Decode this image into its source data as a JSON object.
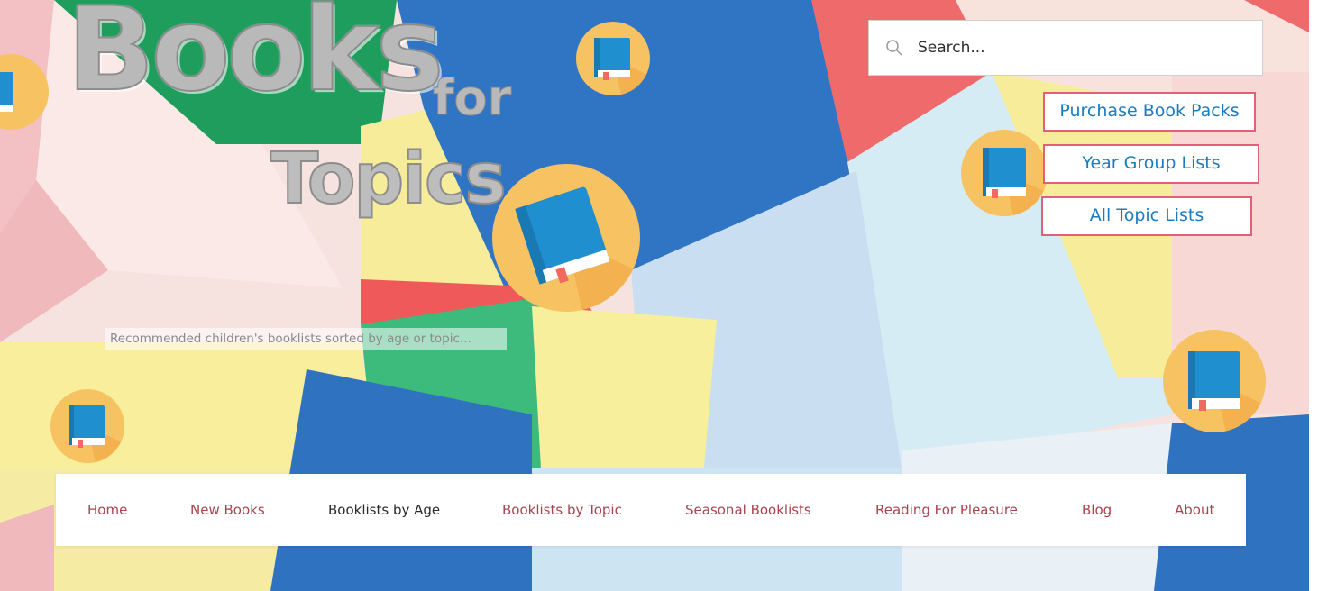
{
  "site": {
    "logo": {
      "word1": "Books",
      "word2": "for",
      "word3": "Topics"
    },
    "tagline": "Recommended children's booklists sorted by age or topic..."
  },
  "search": {
    "placeholder": "Search...",
    "icon": "search-icon"
  },
  "side_links": [
    {
      "label": "Purchase Book Packs"
    },
    {
      "label": "Year Group Lists"
    },
    {
      "label": "All Topic Lists"
    }
  ],
  "nav": {
    "items": [
      {
        "label": "Home",
        "active": false
      },
      {
        "label": "New Books",
        "active": false
      },
      {
        "label": "Booklists by Age",
        "active": true
      },
      {
        "label": "Booklists by Topic",
        "active": false
      },
      {
        "label": "Seasonal Booklists",
        "active": false
      },
      {
        "label": "Reading For Pleasure",
        "active": false
      },
      {
        "label": "Blog",
        "active": false
      },
      {
        "label": "About",
        "active": false
      }
    ]
  },
  "colors": {
    "nav_link": "#a8444e",
    "nav_active": "#2a2a2a",
    "button_border": "#e2607a",
    "button_text": "#1a7bbf",
    "book_blue": "#1f8fd0",
    "badge_orange": "#f7c262"
  },
  "decor_icons": [
    "book-icon"
  ]
}
